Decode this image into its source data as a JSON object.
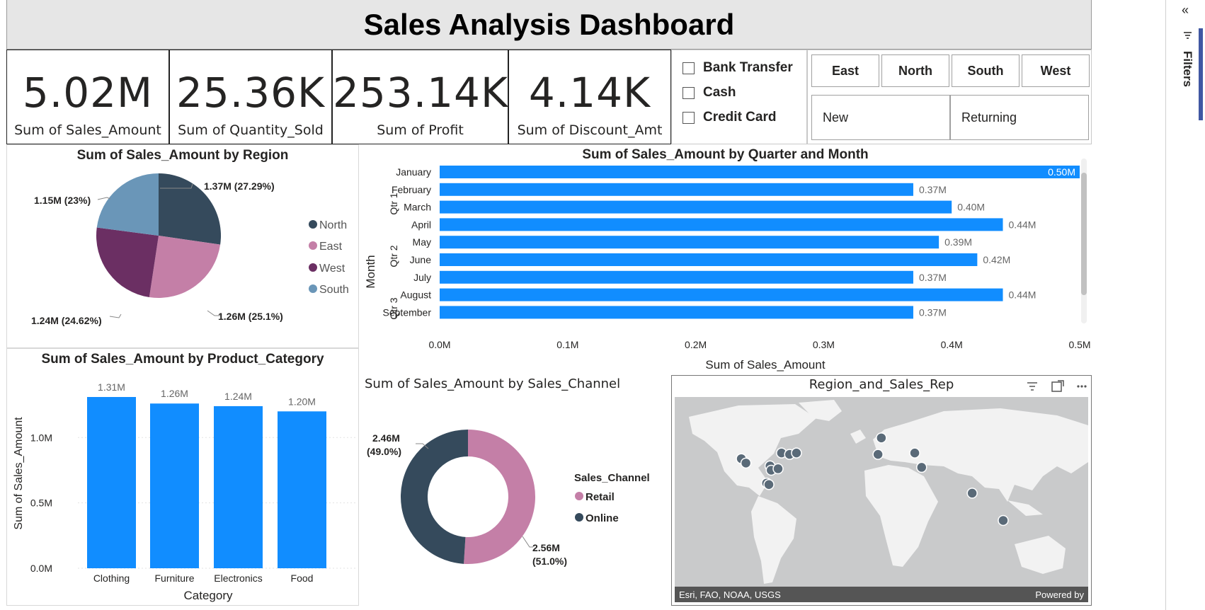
{
  "title": "Sales Analysis Dashboard",
  "kpis": [
    {
      "value": "5.02M",
      "label": "Sum of Sales_Amount"
    },
    {
      "value": "25.36K",
      "label": "Sum of Quantity_Sold"
    },
    {
      "value": "253.14K",
      "label": "Sum of Profit"
    },
    {
      "value": "4.14K",
      "label": "Sum of Discount_Amt"
    }
  ],
  "payment_slicer": {
    "options": [
      "Bank Transfer",
      "Cash",
      "Credit Card"
    ]
  },
  "region_slicer": {
    "options": [
      "East",
      "North",
      "South",
      "West"
    ]
  },
  "customer_slicer": {
    "options": [
      "New",
      "Returning"
    ]
  },
  "region_pie": {
    "title": "Sum of Sales_Amount by Region",
    "legend": [
      "North",
      "East",
      "West",
      "South"
    ],
    "labels": [
      "1.37M (27.29%)",
      "1.26M (25.1%)",
      "1.24M (24.62%)",
      "1.15M (23%)"
    ]
  },
  "month_bar": {
    "title": "Sum of Sales_Amount by Quarter and Month",
    "ylabel": "Month",
    "xlabel": "Sum of Sales_Amount",
    "quarters": [
      "Qtr 1",
      "Qtr 2",
      "Qtr 3"
    ],
    "ticks": [
      "0.0M",
      "0.1M",
      "0.2M",
      "0.3M",
      "0.4M",
      "0.5M"
    ]
  },
  "category_bar": {
    "title": "Sum of Sales_Amount by Product_Category",
    "xlabel": "Category",
    "ylabel": "Sum of Sales_Amount",
    "ticks": [
      "0.0M",
      "0.5M",
      "1.0M"
    ]
  },
  "channel_donut": {
    "title": "Sum of Sales_Amount by Sales_Channel",
    "legend_title": "Sales_Channel",
    "legend": [
      "Retail",
      "Online"
    ],
    "label_online_1": "2.46M",
    "label_online_2": "(49.0%)",
    "label_retail_1": "2.56M",
    "label_retail_2": "(51.0%)"
  },
  "map": {
    "title": "Region_and_Sales_Rep",
    "attribution": "Esri, FAO, NOAA, USGS",
    "powered": "Powered by",
    "points": [
      [
        -122,
        37
      ],
      [
        -118,
        34
      ],
      [
        -97,
        32
      ],
      [
        -96,
        29
      ],
      [
        -100,
        20
      ],
      [
        -87,
        41
      ],
      [
        -80,
        40
      ],
      [
        -74,
        41
      ],
      [
        -90,
        30
      ],
      [
        -0.1,
        51.5
      ],
      [
        -3,
        40
      ],
      [
        29,
        41
      ],
      [
        35,
        31
      ],
      [
        79,
        13
      ],
      [
        106,
        -6
      ],
      [
        -98,
        19
      ]
    ]
  },
  "right_rail": {
    "collapse": "«",
    "filters": "Filters"
  },
  "colors": {
    "bar": "#118dff",
    "north": "#354a5c",
    "east": "#c47fa7",
    "west": "#6b2f63",
    "south": "#6a96b8",
    "online": "#354a5c",
    "retail": "#c47fa7"
  },
  "chart_data": [
    {
      "type": "pie",
      "title": "Sum of Sales_Amount by Region",
      "categories": [
        "North",
        "East",
        "West",
        "South"
      ],
      "values": [
        1.37,
        1.26,
        1.24,
        1.15
      ],
      "percentages": [
        27.29,
        25.1,
        24.62,
        23
      ]
    },
    {
      "type": "bar",
      "orientation": "horizontal",
      "title": "Sum of Sales_Amount by Quarter and Month",
      "categories": [
        "January",
        "February",
        "March",
        "April",
        "May",
        "June",
        "July",
        "August",
        "September"
      ],
      "quarter": [
        "Qtr 1",
        "Qtr 1",
        "Qtr 1",
        "Qtr 2",
        "Qtr 2",
        "Qtr 2",
        "Qtr 3",
        "Qtr 3",
        "Qtr 3"
      ],
      "values": [
        0.5,
        0.37,
        0.4,
        0.44,
        0.39,
        0.42,
        0.37,
        0.44,
        0.37
      ],
      "data_labels": [
        "0.50M",
        "0.37M",
        "0.40M",
        "0.44M",
        "0.39M",
        "0.42M",
        "0.37M",
        "0.44M",
        "0.37M"
      ],
      "xlabel": "Sum of Sales_Amount",
      "ylabel": "Month",
      "xlim": [
        0,
        0.5
      ]
    },
    {
      "type": "bar",
      "title": "Sum of Sales_Amount by Product_Category",
      "categories": [
        "Clothing",
        "Furniture",
        "Electronics",
        "Food"
      ],
      "values": [
        1.31,
        1.26,
        1.24,
        1.2
      ],
      "data_labels": [
        "1.31M",
        "1.26M",
        "1.24M",
        "1.20M"
      ],
      "xlabel": "Category",
      "ylabel": "Sum of Sales_Amount",
      "ylim": [
        0,
        1.31
      ]
    },
    {
      "type": "pie",
      "subtype": "donut",
      "title": "Sum of Sales_Amount by Sales_Channel",
      "categories": [
        "Retail",
        "Online"
      ],
      "values": [
        2.56,
        2.46
      ],
      "percentages": [
        51.0,
        49.0
      ]
    }
  ]
}
